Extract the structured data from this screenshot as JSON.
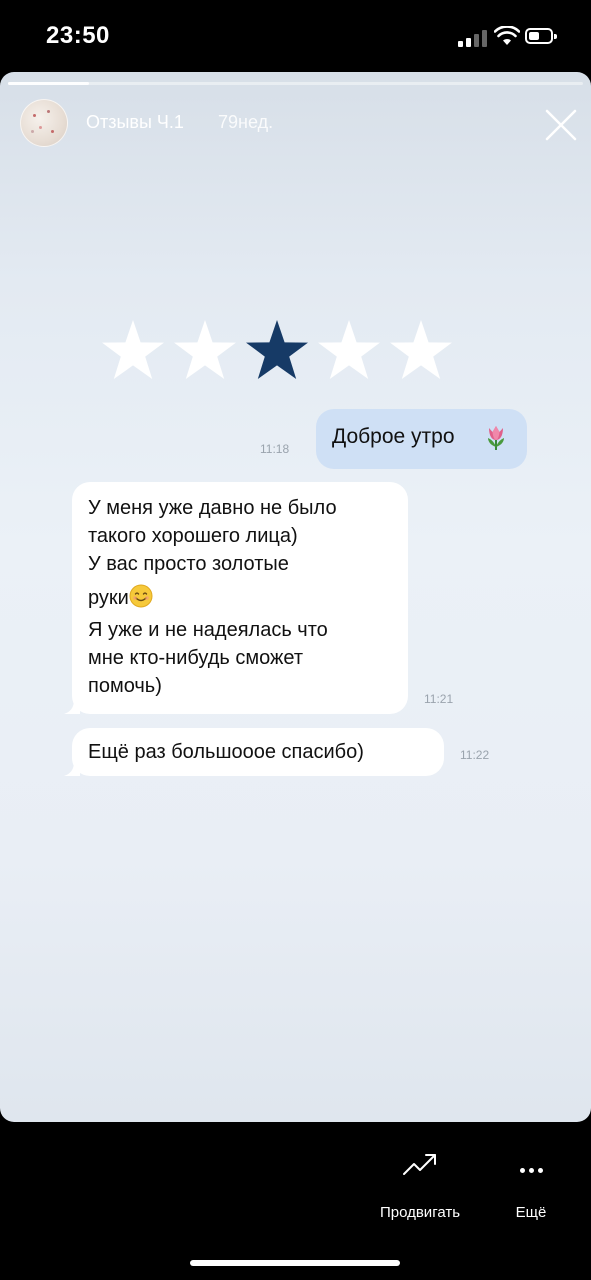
{
  "status_bar": {
    "time": "23:50",
    "icons": [
      "cellular-signal-icon",
      "wifi-icon",
      "battery-icon"
    ]
  },
  "story": {
    "progress_fraction": 0.14,
    "title": "Отзывы Ч.1",
    "age": "79нед.",
    "rating": {
      "total": 5,
      "highlighted_index": 2
    },
    "colors": {
      "star_highlight": "#163a66",
      "star_plain": "#ffffff",
      "outgoing_bubble": "#cfe0f5"
    }
  },
  "chat": {
    "outgoing": {
      "text": "Доброе утро",
      "time": "11:18",
      "emoji": "tulip-icon"
    },
    "incoming_1": {
      "lines": [
        "У меня уже давно не было",
        "такого хорошего лица)",
        "У вас просто золотые",
        "руки",
        "Я уже и не надеялась что",
        "мне кто-нибудь сможет",
        "помочь)"
      ],
      "emoji": "smiling-face-icon",
      "time": "11:21"
    },
    "incoming_2": {
      "text": "Ещё раз большооое спасибо)",
      "time": "11:22"
    }
  },
  "bottom_bar": {
    "promote_label": "Продвигать",
    "more_label": "Ещё"
  }
}
